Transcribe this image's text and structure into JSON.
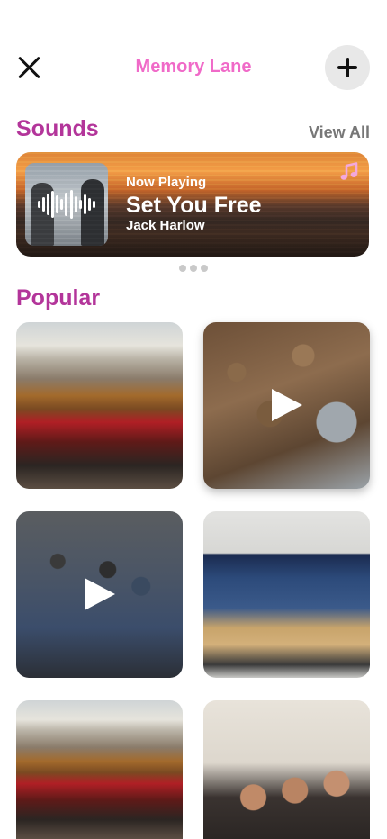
{
  "header": {
    "title": "Memory Lane"
  },
  "sounds": {
    "heading": "Sounds",
    "view_all_label": "View All",
    "now_playing": {
      "label": "Now Playing",
      "song": "Set You Free",
      "artist": "Jack Harlow"
    },
    "pager_dots": 3
  },
  "popular": {
    "heading": "Popular",
    "items": [
      {
        "kind": "photo",
        "icon": "none"
      },
      {
        "kind": "video",
        "icon": "play-icon"
      },
      {
        "kind": "video",
        "icon": "play-icon"
      },
      {
        "kind": "photo",
        "icon": "none"
      },
      {
        "kind": "photo",
        "icon": "none"
      },
      {
        "kind": "photo",
        "icon": "none"
      }
    ]
  },
  "colors": {
    "title_pink": "#f06ac8",
    "section_magenta": "#b3359a",
    "view_all_gray": "#777777",
    "music_icon_pink": "#f3a8dc"
  }
}
